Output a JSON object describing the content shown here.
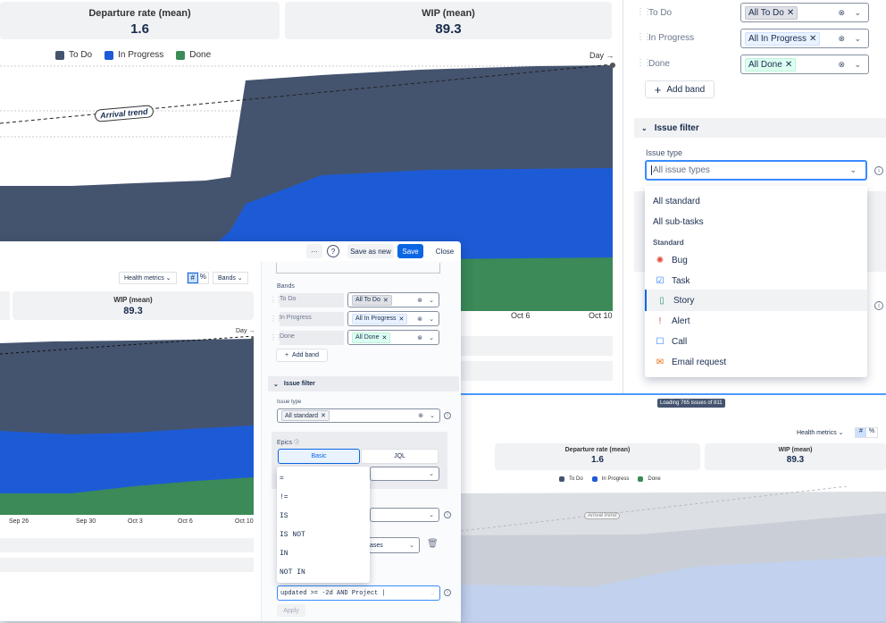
{
  "bg": {
    "cards": [
      {
        "title": "Departure rate (mean)",
        "value": "1.6"
      },
      {
        "title": "WIP (mean)",
        "value": "89.3"
      }
    ],
    "legend": [
      "To Do",
      "In Progress",
      "Done"
    ],
    "day_label": "Day →",
    "trend_label": "Arrival trend",
    "x_ticks": [
      "Oct 6",
      "Oct 10"
    ]
  },
  "right_panel": {
    "bands": [
      {
        "label": "To Do",
        "tag": "All To Do"
      },
      {
        "label": "In Progress",
        "tag": "All In Progress"
      },
      {
        "label": "Done",
        "tag": "All Done"
      }
    ],
    "add_band": "Add band",
    "issue_filter": "Issue filter",
    "issue_type_label": "Issue type",
    "issue_type_placeholder": "All issue types",
    "dropdown": {
      "items_top": [
        "All standard",
        "All sub-tasks"
      ],
      "group": "Standard",
      "items": [
        {
          "label": "Bug",
          "icon": "bug-icon"
        },
        {
          "label": "Task",
          "icon": "task-icon"
        },
        {
          "label": "Story",
          "icon": "story-icon"
        },
        {
          "label": "Alert",
          "icon": "alert-icon"
        },
        {
          "label": "Call",
          "icon": "call-icon"
        },
        {
          "label": "Email request",
          "icon": "email-icon"
        }
      ]
    }
  },
  "modal": {
    "toolbar": {
      "more": "···",
      "help": "?",
      "save_as_new": "Save as new",
      "save": "Save",
      "close": "Close"
    },
    "health_metrics": "Health metrics",
    "bands_dropdown": "Bands",
    "card": {
      "title": "WIP (mean)",
      "value": "89.3"
    },
    "day_label": "Day →",
    "x_ticks": [
      "Sep 26",
      "Sep 30",
      "Oct 3",
      "Oct 6",
      "Oct 10"
    ],
    "bands_label": "Bands",
    "bands": [
      {
        "label": "To Do",
        "tag": "All To Do"
      },
      {
        "label": "In Progress",
        "tag": "All In Progress"
      },
      {
        "label": "Done",
        "tag": "All Done"
      }
    ],
    "add_band": "Add band",
    "issue_filter": "Issue filter",
    "issue_type_label": "Issue type",
    "issue_type_tag": "All standard",
    "epics_label": "Epics",
    "basic": "Basic",
    "jql": "JQL",
    "operators": [
      "=",
      "!=",
      "IS",
      "IS NOT",
      "IN",
      "NOT IN"
    ],
    "partial_text": "ases",
    "jql_value": "updated >= -2d AND Project |",
    "apply": "Apply"
  },
  "bottom_right": {
    "loading": "Loading 765 issues of 811",
    "health_metrics": "Health metrics",
    "cards": [
      {
        "title": "Departure rate (mean)",
        "value": "1.6"
      },
      {
        "title": "WIP (mean)",
        "value": "89.3"
      }
    ],
    "legend": [
      "To Do",
      "In Progress",
      "Done"
    ],
    "trend_label": "Arrival trend"
  },
  "colors": {
    "todo": "#44546f",
    "inprogress": "#1d5bd6",
    "done": "#3b8a57",
    "primary": "#0c66e4"
  }
}
